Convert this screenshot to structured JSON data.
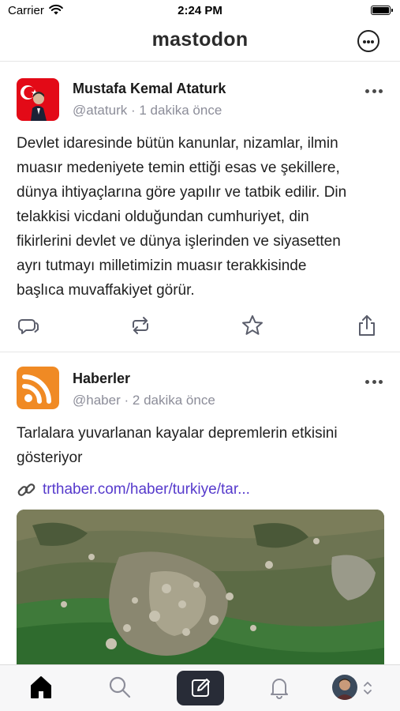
{
  "status_bar": {
    "carrier": "Carrier",
    "time": "2:24 PM"
  },
  "nav": {
    "title": "mastodon",
    "more_icon": "ellipsis-circle-icon"
  },
  "posts": [
    {
      "display_name": "Mustafa Kemal Ataturk",
      "handle": "@ataturk",
      "separator": "·",
      "time_ago": "1 dakika önce",
      "lines": [
        "Devlet idaresinde bütün kanunlar, nizamlar, ilmin",
        "muasır medeniyete temin ettiği esas ve şekillere,",
        "dünya ihtiyaçlarına göre yapılır ve tatbik edilir. Din",
        "telakkisi vicdani olduğundan cumhuriyet, din",
        "fikirlerini devlet ve dünya işlerinden ve siyasetten",
        "ayrı tutmayı milletimizin muasır terakkisinde",
        "başlıca muvaffakiyet görür."
      ],
      "actions": [
        "reply-icon",
        "boost-icon",
        "favourite-icon",
        "share-icon"
      ]
    },
    {
      "display_name": "Haberler",
      "handle": "@haber",
      "separator": "·",
      "time_ago": "2 dakika önce",
      "lines": [
        "Tarlalara yuvarlanan kayalar depremlerin etkisini",
        "gösteriyor"
      ],
      "link_text": "trthaber.com/haber/turkiye/tar...",
      "link_icon": "link-icon"
    }
  ],
  "tab_bar": {
    "items": [
      "home-icon",
      "search-icon",
      "compose-icon",
      "notifications-icon",
      "profile-avatar"
    ],
    "active": "home-icon"
  },
  "colors": {
    "accent": "#563acc",
    "muted": "#8c8d99",
    "text": "#1f1f1f",
    "compose_bg": "#282c37",
    "rss_orange": "#f08a24"
  }
}
